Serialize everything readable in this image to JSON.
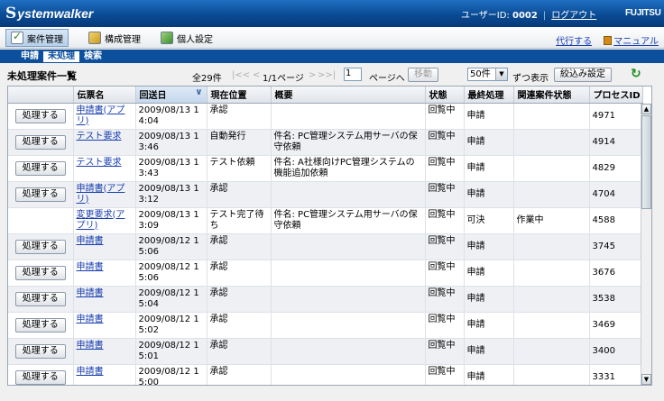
{
  "header": {
    "logo_mark": "S",
    "logo_text": "ystemwalker",
    "user_label": "ユーザーID:",
    "user_id": "0002",
    "logout": "ログアウト",
    "brand": "FUJITSU"
  },
  "menu": {
    "items": [
      {
        "label": "案件管理",
        "icon": "case-management-icon"
      },
      {
        "label": "構成管理",
        "icon": "configuration-icon"
      },
      {
        "label": "個人設定",
        "icon": "personal-settings-icon"
      }
    ],
    "proxy_link": "代行する",
    "manual_link": "マニュアル"
  },
  "subtabs": [
    "申請",
    "未処理",
    "検索"
  ],
  "list": {
    "title": "未処理案件一覧",
    "total": "全29件",
    "first": "|<<",
    "prev": "<",
    "page_info": "1/1ページ",
    "next": ">",
    "last": ">>|",
    "page_value": "1",
    "page_to": "ページへ",
    "move_button": "移動",
    "per_page": "50件",
    "per_page_suffix": "ずつ表示",
    "filter_button": "絞込み設定",
    "sort_indicator": "∨"
  },
  "columns": [
    "",
    "伝票名",
    "回送日",
    "現在位置",
    "概要",
    "状態",
    "最終処理",
    "関連案件状態",
    "プロセスID"
  ],
  "rows": [
    {
      "action": "処理する",
      "name": "申請書(アプリ)",
      "date": "2009/08/13 1 4:04",
      "location": "承認",
      "summary": "",
      "status": "回覧中",
      "last": "申請",
      "related": "",
      "pid": "4971"
    },
    {
      "action": "処理する",
      "name": "テスト要求",
      "date": "2009/08/13 1 3:46",
      "location": "自動発行",
      "summary": "件名: PC管理システム用サーバの保守依頼",
      "status": "回覧中",
      "last": "申請",
      "related": "",
      "pid": "4914"
    },
    {
      "action": "処理する",
      "name": "テスト要求",
      "date": "2009/08/13 1 3:43",
      "location": "テスト依頼",
      "summary": "件名: A社様向けPC管理システムの機能追加依頼",
      "status": "回覧中",
      "last": "申請",
      "related": "",
      "pid": "4829"
    },
    {
      "action": "処理する",
      "name": "申請書(アプリ)",
      "date": "2009/08/13 1 3:12",
      "location": "承認",
      "summary": "",
      "status": "回覧中",
      "last": "申請",
      "related": "",
      "pid": "4704"
    },
    {
      "action": "",
      "name": "変更要求(アプリ)",
      "date": "2009/08/13 1 3:09",
      "location": "テスト完了待ち",
      "summary": "件名: PC管理システム用サーバの保守依頼",
      "status": "回覧中",
      "last": "可決",
      "related": "作業中",
      "pid": "4588"
    },
    {
      "action": "処理する",
      "name": "申請書",
      "date": "2009/08/12 1 5:06",
      "location": "承認",
      "summary": "",
      "status": "回覧中",
      "last": "申請",
      "related": "",
      "pid": "3745"
    },
    {
      "action": "処理する",
      "name": "申請書",
      "date": "2009/08/12 1 5:06",
      "location": "承認",
      "summary": "",
      "status": "回覧中",
      "last": "申請",
      "related": "",
      "pid": "3676"
    },
    {
      "action": "処理する",
      "name": "申請書",
      "date": "2009/08/12 1 5:04",
      "location": "承認",
      "summary": "",
      "status": "回覧中",
      "last": "申請",
      "related": "",
      "pid": "3538"
    },
    {
      "action": "処理する",
      "name": "申請書",
      "date": "2009/08/12 1 5:02",
      "location": "承認",
      "summary": "",
      "status": "回覧中",
      "last": "申請",
      "related": "",
      "pid": "3469"
    },
    {
      "action": "処理する",
      "name": "申請書",
      "date": "2009/08/12 1 5:01",
      "location": "承認",
      "summary": "",
      "status": "回覧中",
      "last": "申請",
      "related": "",
      "pid": "3400"
    },
    {
      "action": "処理する",
      "name": "申請書",
      "date": "2009/08/12 1 5:00",
      "location": "承認",
      "summary": "",
      "status": "回覧中",
      "last": "申請",
      "related": "",
      "pid": "3331"
    }
  ],
  "colors": {
    "header_blue": "#0a4b94",
    "tab_blue": "#0c4f9c",
    "link": "#1a3fb0",
    "refresh": "#1b8a1b"
  }
}
